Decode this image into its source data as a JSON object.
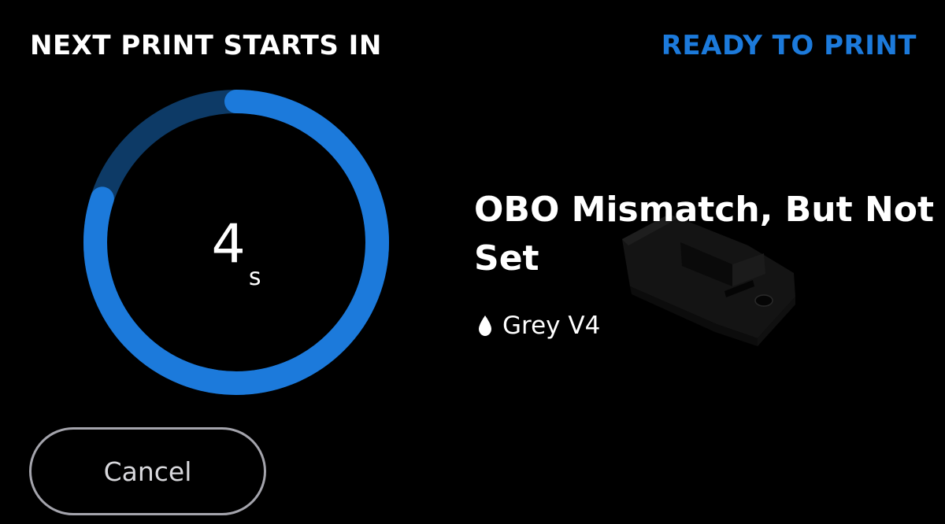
{
  "header": {
    "countdown_label": "NEXT PRINT STARTS IN",
    "status_label": "READY TO PRINT"
  },
  "countdown": {
    "value": "4",
    "unit": "s",
    "progress_fraction": 0.8
  },
  "job": {
    "title": "OBO Mismatch, But Not Set",
    "material": "Grey V4",
    "material_icon": "resin-drop-icon"
  },
  "actions": {
    "cancel_label": "Cancel"
  },
  "colors": {
    "background": "#000000",
    "accent": "#1c7adb",
    "ring_track": "#0d3a66",
    "button_border": "#a4a4ac"
  }
}
